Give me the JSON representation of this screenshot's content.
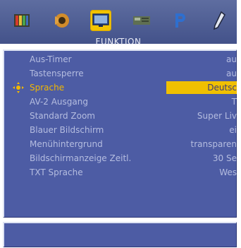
{
  "header": {
    "tabs": [
      {
        "icon": "tv-picture-icon"
      },
      {
        "icon": "speaker-icon"
      },
      {
        "icon": "monitor-icon",
        "active": true
      },
      {
        "icon": "device-icon"
      },
      {
        "icon": "letter-p-icon"
      },
      {
        "icon": "stylus-icon"
      }
    ],
    "title": "FUNKTION"
  },
  "menu": {
    "items": [
      {
        "label": "Aus-Timer",
        "value": "au"
      },
      {
        "label": "Tastensperre",
        "value": "au"
      },
      {
        "label": "Sprache",
        "value": "Deutsc",
        "selected": true
      },
      {
        "label": "AV-2 Ausgang",
        "value": "T"
      },
      {
        "label": "Standard Zoom",
        "value": "Super Liv"
      },
      {
        "label": "Blauer Bildschirm",
        "value": "ei"
      },
      {
        "label": "Menühintergrund",
        "value": "transparen"
      },
      {
        "label": "Bildschirmanzeige Zeitl.",
        "value": "30 Se"
      },
      {
        "label": "TXT Sprache",
        "value": "Wes"
      }
    ]
  },
  "colors": {
    "panel": "#4d5ca4",
    "accent": "#f0c000",
    "text": "#b5bde0"
  }
}
